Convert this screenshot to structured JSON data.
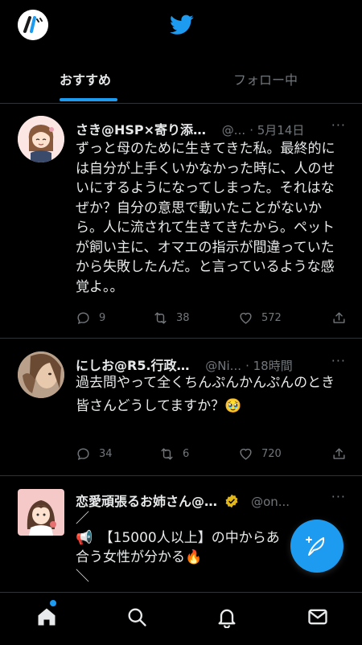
{
  "header": {
    "tabs": [
      {
        "label": "おすすめ",
        "active": true
      },
      {
        "label": "フォロー中",
        "active": false
      }
    ]
  },
  "tweets": [
    {
      "name": "さき@HSP×寄り添…",
      "handle": "@...",
      "time": "5月14日",
      "body": "ずっと母のために生きてきた私。最終的には自分が上手くいかなかった時に、人のせいにするようになってしまった。それはなぜか？自分の意思で動いたことがないから。人に流されて生きてきたから。ペットが飼い主に、オマエの指示が間違っていたから失敗したんだ。と言っているような感覚よ。。",
      "replies": "9",
      "retweets": "38",
      "likes": "572"
    },
    {
      "name": "にしお@R5.行政…",
      "handle": "@Ni...",
      "time": "18時間",
      "body_line1": "過去問やって全くちんぷんかんぷんのとき",
      "body_line2": "皆さんどうしてますか？🥹",
      "replies": "34",
      "retweets": "6",
      "likes": "720"
    },
    {
      "name": "恋愛頑張るお姉さん@…",
      "handle": "@on...",
      "line1": "／",
      "line2": "📢　【15000人以上】の中からあ",
      "line3": "合う女性が分かる🔥",
      "line4": "＼"
    }
  ],
  "icons": {
    "logo": "twitter-bird-icon",
    "fab": "compose-feather-icon",
    "nav": [
      "home-icon",
      "search-icon",
      "bell-icon",
      "mail-icon"
    ]
  },
  "colors": {
    "accent": "#1d9bf0",
    "background": "#000000",
    "muted": "#71767b"
  }
}
